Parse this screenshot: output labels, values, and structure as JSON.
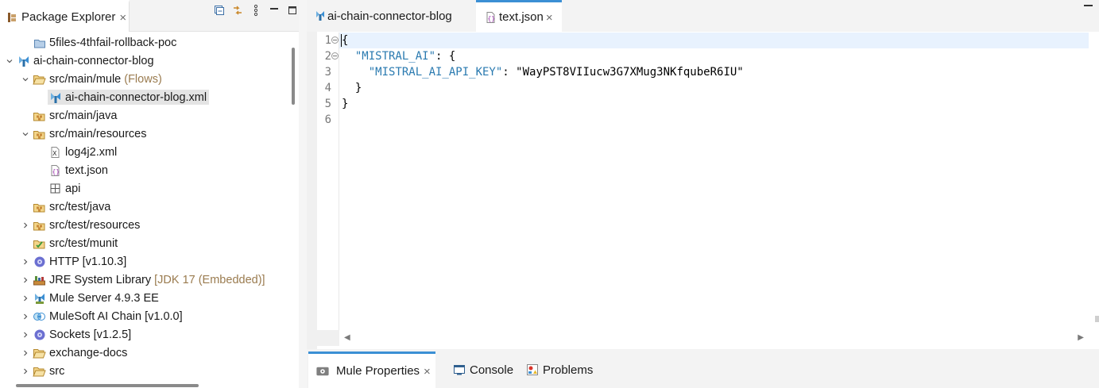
{
  "package_explorer": {
    "tab_label": "Package Explorer",
    "tree": [
      {
        "label": "5files-4thfail-rollback-poc",
        "decoration": "",
        "icon": "project-icon",
        "level": 1,
        "chevron": "none",
        "selected": false
      },
      {
        "label": "ai-chain-connector-blog",
        "decoration": "",
        "icon": "mule-project-icon",
        "level": 0,
        "chevron": "down",
        "selected": false
      },
      {
        "label": "src/main/mule",
        "decoration": "(Flows)",
        "icon": "open-folder-icon",
        "level": 1,
        "chevron": "down",
        "selected": false
      },
      {
        "label": "ai-chain-connector-blog.xml",
        "decoration": "",
        "icon": "mule-file-icon",
        "level": 2,
        "chevron": "none",
        "selected": true
      },
      {
        "label": "src/main/java",
        "decoration": "",
        "icon": "package-folder-icon",
        "level": 1,
        "chevron": "none",
        "selected": false
      },
      {
        "label": "src/main/resources",
        "decoration": "",
        "icon": "package-folder-icon",
        "level": 1,
        "chevron": "down",
        "selected": false
      },
      {
        "label": "log4j2.xml",
        "decoration": "",
        "icon": "xml-file-icon",
        "level": 2,
        "chevron": "none",
        "selected": false
      },
      {
        "label": "text.json",
        "decoration": "",
        "icon": "json-file-icon",
        "level": 2,
        "chevron": "none",
        "selected": false
      },
      {
        "label": "api",
        "decoration": "",
        "icon": "grid-folder-icon",
        "level": 2,
        "chevron": "none",
        "selected": false
      },
      {
        "label": "src/test/java",
        "decoration": "",
        "icon": "package-folder-icon",
        "level": 1,
        "chevron": "none",
        "selected": false
      },
      {
        "label": "src/test/resources",
        "decoration": "",
        "icon": "package-folder-icon",
        "level": 1,
        "chevron": "right",
        "selected": false
      },
      {
        "label": "src/test/munit",
        "decoration": "",
        "icon": "munit-folder-icon",
        "level": 1,
        "chevron": "none",
        "selected": false
      },
      {
        "label": "HTTP [v1.10.3]",
        "decoration": "",
        "icon": "connector-icon",
        "level": 1,
        "chevron": "right",
        "selected": false
      },
      {
        "label": "JRE System Library",
        "decoration": "[JDK 17 (Embedded)]",
        "icon": "library-icon",
        "level": 1,
        "chevron": "right",
        "selected": false
      },
      {
        "label": "Mule Server 4.9.3 EE",
        "decoration": "",
        "icon": "mule-server-icon",
        "level": 1,
        "chevron": "right",
        "selected": false
      },
      {
        "label": "MuleSoft AI Chain [v1.0.0]",
        "decoration": "",
        "icon": "ai-chain-icon",
        "level": 1,
        "chevron": "right",
        "selected": false
      },
      {
        "label": "Sockets [v1.2.5]",
        "decoration": "",
        "icon": "connector-icon",
        "level": 1,
        "chevron": "right",
        "selected": false
      },
      {
        "label": "exchange-docs",
        "decoration": "",
        "icon": "open-folder-icon",
        "level": 1,
        "chevron": "right",
        "selected": false
      },
      {
        "label": "src",
        "decoration": "",
        "icon": "open-folder-icon",
        "level": 1,
        "chevron": "right",
        "selected": false
      }
    ]
  },
  "editor": {
    "tabs": [
      {
        "label": "ai-chain-connector-blog",
        "active": false
      },
      {
        "label": "text.json",
        "active": true
      }
    ],
    "lines": [
      {
        "num": "1",
        "fold": true
      },
      {
        "num": "2",
        "fold": true
      },
      {
        "num": "3",
        "fold": false
      },
      {
        "num": "4",
        "fold": false
      },
      {
        "num": "5",
        "fold": false
      },
      {
        "num": "6",
        "fold": false
      }
    ],
    "code": {
      "l1_brace": "{",
      "l2_key": "\"MISTRAL_AI\"",
      "l2_rest": ": {",
      "l3_key": "\"MISTRAL_AI_API_KEY\"",
      "l3_colon": ": ",
      "l3_value": "\"WayPST8VIIucw3G7XMug3NKfqubeR6IU\"",
      "l4": "}",
      "l5": "}"
    }
  },
  "bottom_panel": {
    "tabs": [
      {
        "label": "Mule Properties",
        "active": true
      },
      {
        "label": "Console",
        "active": false
      },
      {
        "label": "Problems",
        "active": false
      }
    ]
  },
  "colors": {
    "accent": "#3b8fd4",
    "json_key": "#2a7ab0",
    "decoration": "#9a7b4f",
    "current_line": "#e8f2fe"
  }
}
